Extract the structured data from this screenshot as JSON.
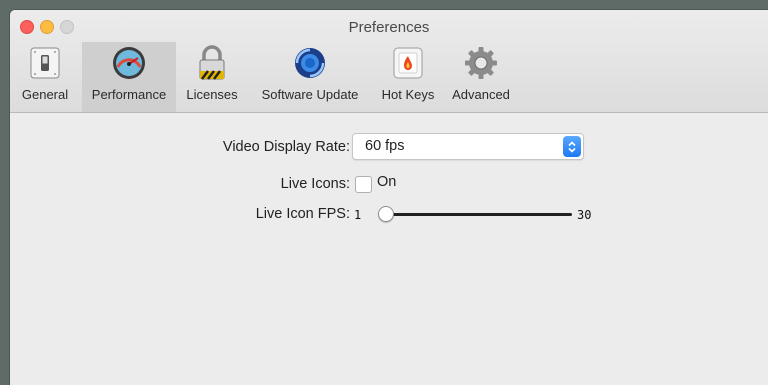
{
  "window": {
    "title": "Preferences"
  },
  "toolbar": {
    "tabs": [
      {
        "label": "General",
        "icon": "switch-icon"
      },
      {
        "label": "Performance",
        "icon": "gauge-icon",
        "selected": true
      },
      {
        "label": "Licenses",
        "icon": "lock-icon"
      },
      {
        "label": "Software Update",
        "icon": "sync-icon"
      },
      {
        "label": "Hot Keys",
        "icon": "flame-key-icon"
      },
      {
        "label": "Advanced",
        "icon": "gear-icon"
      }
    ]
  },
  "performance": {
    "video_display_rate": {
      "label": "Video Display Rate:",
      "value": "60 fps"
    },
    "live_icons": {
      "label": "Live Icons:",
      "checkbox_label": "On",
      "checked": false
    },
    "live_icon_fps": {
      "label": "Live Icon FPS:",
      "min": "1",
      "max": "30",
      "level": 0
    }
  },
  "colors": {
    "close": "#fc605b",
    "minimize": "#fdbc40",
    "accent": "#1d79f2"
  }
}
